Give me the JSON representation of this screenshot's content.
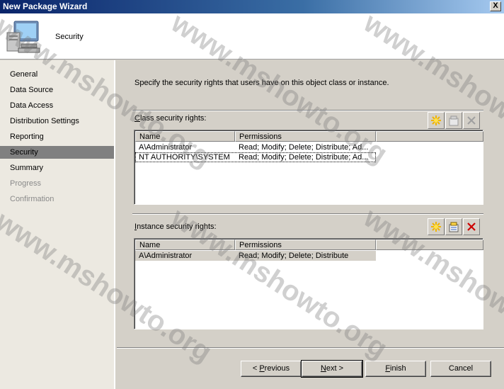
{
  "window": {
    "title": "New Package Wizard",
    "close_label": "X"
  },
  "header": {
    "title": "Security",
    "icon": "computer-icon"
  },
  "sidebar": {
    "items": [
      {
        "label": "General",
        "state": "normal"
      },
      {
        "label": "Data Source",
        "state": "normal"
      },
      {
        "label": "Data Access",
        "state": "normal"
      },
      {
        "label": "Distribution Settings",
        "state": "normal"
      },
      {
        "label": "Reporting",
        "state": "normal"
      },
      {
        "label": "Security",
        "state": "active"
      },
      {
        "label": "Summary",
        "state": "normal"
      },
      {
        "label": "Progress",
        "state": "disabled"
      },
      {
        "label": "Confirmation",
        "state": "disabled"
      }
    ]
  },
  "main": {
    "intro": "Specify the security rights that users have on this object class or instance.",
    "class_rights": {
      "label_underlined": "C",
      "label_rest": "lass security rights:",
      "columns": [
        "Name",
        "Permissions"
      ],
      "rows": [
        {
          "name": "A\\Administrator",
          "permissions": "Read; Modify; Delete; Distribute; Ad..."
        },
        {
          "name": "NT AUTHORITY\\SYSTEM",
          "permissions": "Read; Modify; Delete; Distribute; Ad..."
        }
      ]
    },
    "instance_rights": {
      "label_underlined": "I",
      "label_rest": "nstance security rights:",
      "columns": [
        "Name",
        "Permissions"
      ],
      "rows": [
        {
          "name": "A\\Administrator",
          "permissions": "Read; Modify; Delete; Distribute"
        }
      ]
    }
  },
  "buttons": {
    "previous_prefix": "< ",
    "previous_ul": "P",
    "previous_rest": "revious",
    "next_ul": "N",
    "next_rest": "ext >",
    "finish_ul": "F",
    "finish_rest": "inish",
    "cancel": "Cancel"
  },
  "watermark": "www.mshowto.org",
  "colors": {
    "title_bar": "#0a246a",
    "selected_nav": "#808080",
    "delete_red": "#cc0000",
    "new_star": "#f5c800"
  }
}
